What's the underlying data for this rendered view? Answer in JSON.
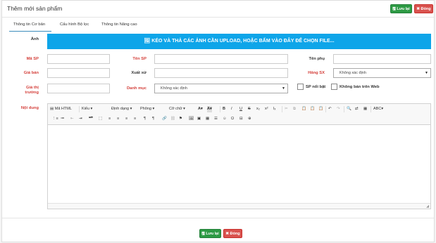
{
  "dialog": {
    "title": "Thêm mới sản phẩm",
    "save_label": "Lưu lại",
    "close_label": "Đóng"
  },
  "tabs": [
    "Thông tin Cơ bản",
    "Cấu hình Bộ lọc",
    "Thông tin Nâng cao"
  ],
  "form": {
    "image_label": "Ảnh",
    "upload_text": "KÉO VÀ THẢ CÁC ẢNH CẦN UPLOAD, HOẶC BẤM VÀO ĐÂY ĐỂ CHỌN FILE...",
    "code_label": "Mã SP",
    "name_label": "Tên SP",
    "subname_label": "Tên phụ",
    "price_label": "Giá bán",
    "origin_label": "Xuất xứ",
    "maker_label": "Hãng SX",
    "maker_value": "Không xác định",
    "market_price_label": "Giá thị trường",
    "category_label": "Danh mục",
    "category_value": "Không xác định",
    "featured_label": "SP nổi bật",
    "not_web_label": "Không bán trên Web",
    "content_label": "Nội dung"
  },
  "editor": {
    "row1": [
      "Mã HTML",
      "Kiểu",
      "Định dạng",
      "Phông",
      "Cỡ chữ",
      "A",
      "A",
      "B",
      "I",
      "U",
      "S",
      "x₂",
      "x²",
      "Iₓ",
      "✂",
      "⧉",
      "📋",
      "📋",
      "📋",
      "↶",
      "↷",
      "🔍",
      "⇄",
      "▦",
      "▾"
    ],
    "row2": [
      "⋮≡",
      "≔",
      "⇤",
      "⇥",
      "❝❞",
      "⬚",
      "≡",
      "≡",
      "≡",
      "≡",
      "¶",
      "¶",
      "🔗",
      "⛓",
      "⚑",
      "🖼",
      "▣",
      "▦",
      "☰",
      "☺",
      "Ω",
      "⊟",
      "⊕"
    ]
  },
  "colors": {
    "upload_bg": "#0ea5e9",
    "save": "#2d9a44",
    "close": "#d9534f",
    "required_label": "#d43f3a",
    "tab_active": "#3c8dbc"
  }
}
